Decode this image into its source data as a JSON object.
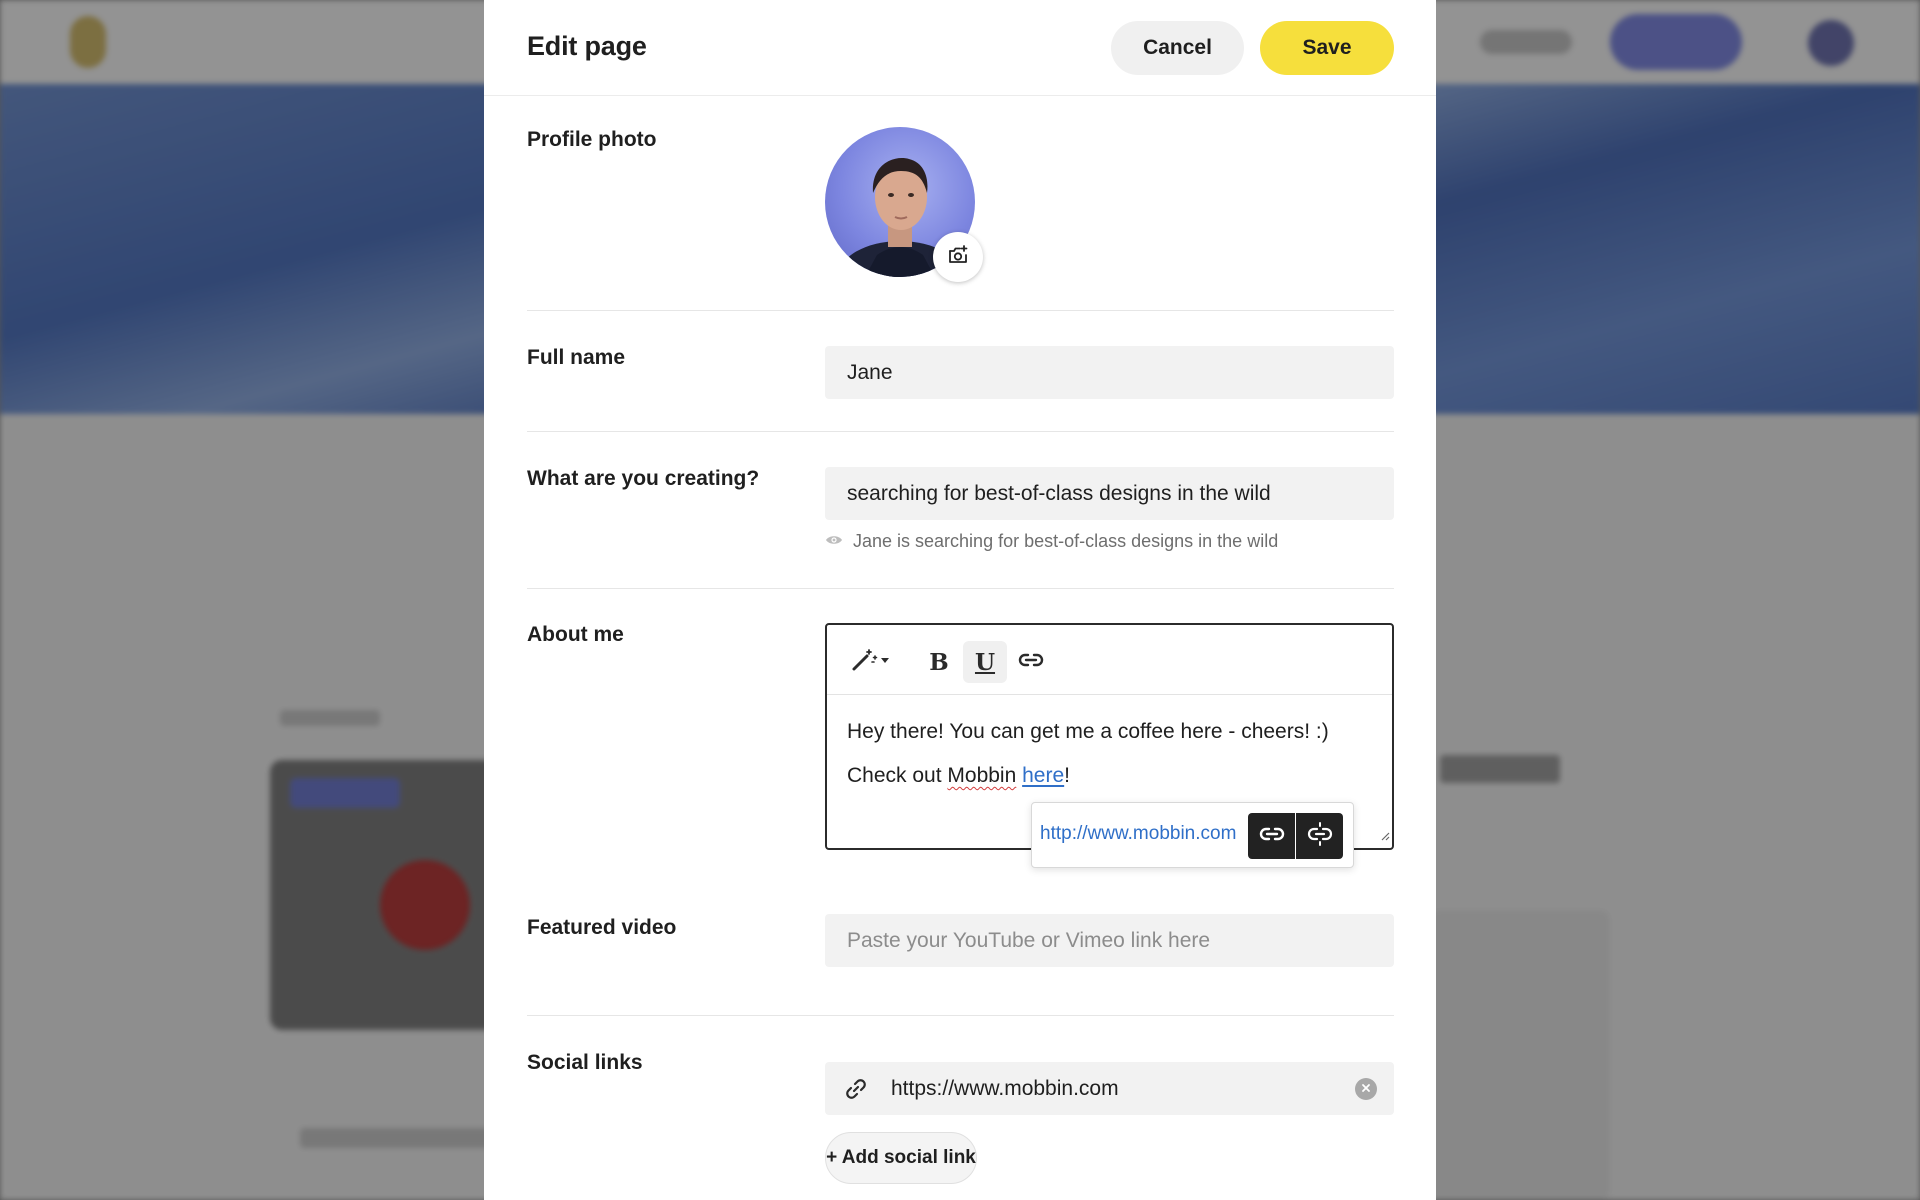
{
  "modal": {
    "title": "Edit page",
    "cancel_label": "Cancel",
    "save_label": "Save"
  },
  "profile_photo": {
    "label": "Profile photo",
    "change_icon": "camera-plus-icon"
  },
  "full_name": {
    "label": "Full name",
    "value": "Jane"
  },
  "creating": {
    "label": "What are you creating?",
    "value": "searching for best-of-class designs in the wild",
    "preview_icon": "eye-icon",
    "preview_text": "Jane is searching for best-of-class designs in the wild"
  },
  "about": {
    "label": "About me",
    "toolbar": {
      "magic_icon": "magic-wand-icon",
      "bold_label": "B",
      "underline_label": "U",
      "link_icon": "link-icon"
    },
    "line1": "Hey there! You can get me a coffee here - cheers! :)",
    "line2_prefix": "Check out ",
    "line2_word": "Mobbin",
    "line2_link": "here",
    "line2_suffix": "!",
    "popup_url": "http://www.mobbin.com"
  },
  "featured_video": {
    "label": "Featured video",
    "placeholder": "Paste your YouTube or Vimeo link here"
  },
  "social_links": {
    "label": "Social links",
    "value": "https://www.mobbin.com",
    "add_label": "+ Add social link"
  },
  "colors": {
    "save": "#f6df3c",
    "link": "#2f6fc8"
  }
}
